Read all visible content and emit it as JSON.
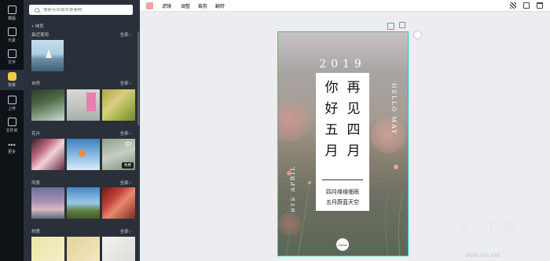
{
  "rail": {
    "items": [
      {
        "label": "模版",
        "icon": "template-icon"
      },
      {
        "label": "元素",
        "icon": "elements-icon"
      },
      {
        "label": "文字",
        "icon": "text-icon"
      },
      {
        "label": "背景",
        "icon": "background-icon",
        "active": true
      },
      {
        "label": "上传",
        "icon": "upload-icon"
      },
      {
        "label": "文件夹",
        "icon": "folder-icon"
      },
      {
        "label": "更多",
        "icon": "more-icon"
      }
    ]
  },
  "panel": {
    "search_placeholder": "搜索专业版背景素材",
    "pure_color": "+ 纯色",
    "sections": [
      {
        "title": "最近使用",
        "more": "全部 ›"
      },
      {
        "title": "自然",
        "more": "全部 ›"
      },
      {
        "title": "花卉",
        "more": "全部 ›"
      },
      {
        "title": "风景",
        "more": "全部 ›"
      },
      {
        "title": "材质",
        "more": "全部 ›"
      }
    ],
    "free_badge": "免费"
  },
  "toolbar": {
    "swatch_color": "#eea4a8",
    "buttons": [
      "滤镜",
      "调整",
      "裁剪",
      "翻转"
    ]
  },
  "poster": {
    "year": "2019",
    "col_left": [
      "你",
      "好",
      "五",
      "月"
    ],
    "col_right": [
      "再",
      "见",
      "四",
      "月"
    ],
    "line1": "四月缘缘细雨",
    "line2": "五月蔚蓝天空",
    "vertical_right": "HELLO MAY",
    "vertical_left": "BYE APRIL",
    "logo": "Canva"
  },
  "watermark": {
    "text": "KK下载",
    "url": "www.kkx.net"
  }
}
